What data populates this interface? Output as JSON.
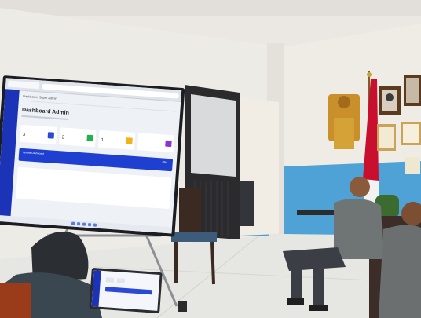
{
  "scene": {
    "description_items": [
      "tv-display",
      "laptop",
      "seated-people",
      "wall-frames",
      "indonesian-flag"
    ]
  },
  "tv_screen": {
    "page_title": "Dashboard Super Admin",
    "heading": "Dashboard Admin",
    "stats": [
      {
        "value": "3",
        "icon_color": "#2c49d6"
      },
      {
        "value": "2",
        "icon_color": "#22b24c"
      },
      {
        "value": "1",
        "icon_color": "#f2b318"
      },
      {
        "value": "",
        "icon_color": "#8a34d6"
      }
    ],
    "banner": {
      "label": "Update Dashboard",
      "percent": "0%"
    }
  },
  "colors": {
    "accent": "#1f3fd0",
    "wall": "#ece9e4",
    "wainscot": "#4ea2d6",
    "floor": "#e6e6e3",
    "flag_red": "#c8102e"
  }
}
